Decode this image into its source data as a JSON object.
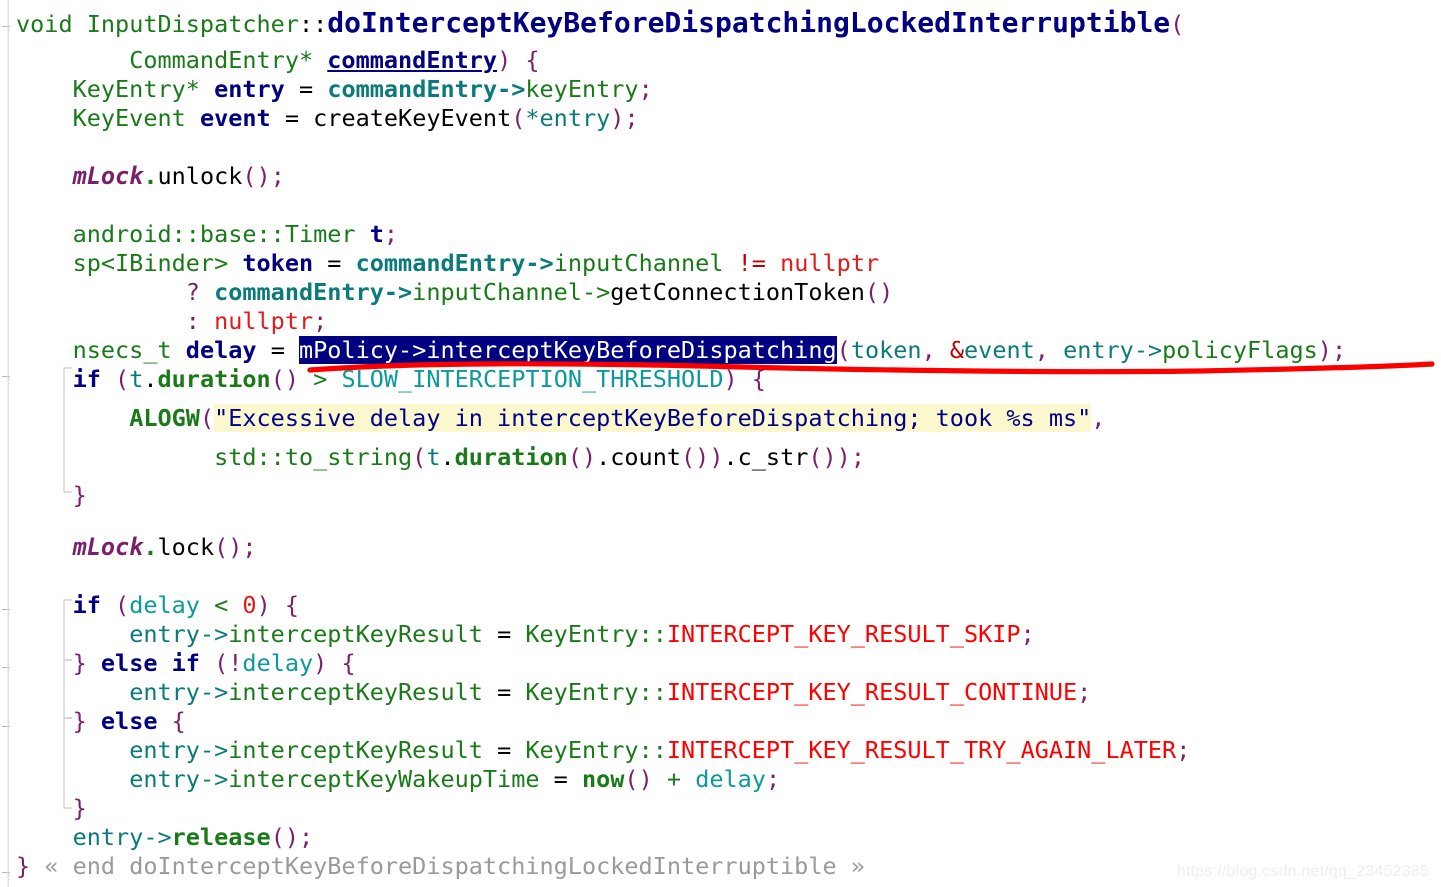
{
  "app": {
    "kind": "source-code-viewer",
    "language": "C++",
    "background": "#ffffff",
    "watermark": "https://blog.csdn.net/qq_23452385"
  },
  "colors": {
    "keyword": "#000080",
    "type": "#1a7a1a",
    "variable_teal": "#0b7a7a",
    "punctuation": "#7a1f6b",
    "constant_red": "#ff0000",
    "nullptr_red": "#e01b1b",
    "string_text": "#00008b",
    "string_highlight_bg": "#fbf8cd",
    "selection_bg": "#000080",
    "selection_fg": "#ffffff",
    "member_purple": "#7a1f6b",
    "cyan_const": "#0b9a9a",
    "fold_gray": "#9a9a9a",
    "annotation_red": "#ff0000",
    "watermark_gray": "#eeeeee"
  },
  "annotation": {
    "type": "hand-drawn-underline",
    "color": "#ff0000",
    "target_line_index": 10,
    "description": "red freehand underline beneath the mPolicy->interceptKeyBeforeDispatching call"
  },
  "selection": {
    "text": "mPolicy->interceptKeyBeforeDispatching",
    "line_index": 10,
    "background": "#000080",
    "foreground": "#ffffff"
  },
  "code": {
    "lines": [
      {
        "i": 0,
        "text": "void InputDispatcher::doInterceptKeyBeforeDispatchingLockedInterruptible(",
        "fold_tick": true
      },
      {
        "i": 1,
        "text": "        CommandEntry* commandEntry) {"
      },
      {
        "i": 2,
        "text": "    KeyEntry* entry = commandEntry->keyEntry;"
      },
      {
        "i": 3,
        "text": "    KeyEvent event = createKeyEvent(*entry);"
      },
      {
        "i": 4,
        "text": ""
      },
      {
        "i": 5,
        "text": "    mLock.unlock();"
      },
      {
        "i": 6,
        "text": ""
      },
      {
        "i": 7,
        "text": "    android::base::Timer t;"
      },
      {
        "i": 8,
        "text": "    sp<IBinder> token = commandEntry->inputChannel != nullptr"
      },
      {
        "i": 9,
        "text": "            ? commandEntry->inputChannel->getConnectionToken()"
      },
      {
        "i": 10,
        "text": "            : nullptr;"
      },
      {
        "i": 11,
        "text": "    nsecs_t delay = mPolicy->interceptKeyBeforeDispatching(token, &event, entry->policyFlags);"
      },
      {
        "i": 12,
        "text": "    if (t.duration() > SLOW_INTERCEPTION_THRESHOLD) {",
        "fold_tick": true
      },
      {
        "i": 13,
        "text": "        ALOGW(\"Excessive delay in interceptKeyBeforeDispatching; took %s ms\","
      },
      {
        "i": 14,
        "text": "              std::to_string(t.duration().count()).c_str());"
      },
      {
        "i": 15,
        "text": "    }"
      },
      {
        "i": 16,
        "text": ""
      },
      {
        "i": 17,
        "text": "    mLock.lock();"
      },
      {
        "i": 18,
        "text": ""
      },
      {
        "i": 19,
        "text": "    if (delay < 0) {",
        "fold_tick": true
      },
      {
        "i": 20,
        "text": "        entry->interceptKeyResult = KeyEntry::INTERCEPT_KEY_RESULT_SKIP;"
      },
      {
        "i": 21,
        "text": "    } else if (!delay) {",
        "fold_tick": true
      },
      {
        "i": 22,
        "text": "        entry->interceptKeyResult = KeyEntry::INTERCEPT_KEY_RESULT_CONTINUE;"
      },
      {
        "i": 23,
        "text": "    } else {",
        "fold_tick": true
      },
      {
        "i": 24,
        "text": "        entry->interceptKeyResult = KeyEntry::INTERCEPT_KEY_RESULT_TRY_AGAIN_LATER;"
      },
      {
        "i": 25,
        "text": "        entry->interceptKeyWakeupTime = now() + delay;"
      },
      {
        "i": 26,
        "text": "    }"
      },
      {
        "i": 27,
        "text": "    entry->release();"
      },
      {
        "i": 28,
        "text": "} « end doInterceptKeyBeforeDispatchingLockedInterruptible »",
        "fold_tick": true
      }
    ],
    "tokens": {
      "l0_void": "void",
      "l0_class": "InputDispatcher",
      "l0_scope": "::",
      "l0_fn": "doInterceptKeyBeforeDispatchingLockedInterruptible",
      "l0_lparen": "(",
      "l1_type": "CommandEntry*",
      "l1_param": "commandEntry",
      "l1_rparen": ")",
      "l1_brace": "{",
      "l2_type": "KeyEntry*",
      "l2_var": "entry",
      "l2_eq": "=",
      "l2_obj": "commandEntry",
      "l2_arrow": "->",
      "l2_field": "keyEntry",
      "l2_semi": ";",
      "l3_type": "KeyEvent",
      "l3_var": "event",
      "l3_eq": "=",
      "l3_fn": "createKeyEvent",
      "l3_arg": "*entry",
      "l5_member": "mLock",
      "l5_dot": ".",
      "l5_fn": "unlock",
      "l7_ns": "android::base::Timer",
      "l7_var": "t",
      "l8_tpl": "sp<IBinder>",
      "l8_var": "token",
      "l8_obj": "commandEntry",
      "l8_field": "inputChannel",
      "l8_op": "!=",
      "l8_null": "nullptr",
      "l9_q": "?",
      "l9_fn": "getConnectionToken",
      "l10_colon": ":",
      "l10_null": "nullptr",
      "l11_type": "nsecs_t",
      "l11_var": "delay",
      "l11_sel": "mPolicy->interceptKeyBeforeDispatching",
      "l11_args": "token, &event, entry->policyFlags",
      "l12_if": "if",
      "l12_t": "t",
      "l12_duration": "duration",
      "l12_gt": ">",
      "l12_const": "SLOW_INTERCEPTION_THRESHOLD",
      "l13_macro": "ALOGW",
      "l13_string": "\"Excessive delay in interceptKeyBeforeDispatching; took %s ms\"",
      "l14_std": "std::to_string",
      "l14_count": "count",
      "l14_cstr": "c_str",
      "l17_member": "mLock",
      "l17_fn": "lock",
      "l19_if": "if",
      "l19_delay": "delay",
      "l19_lt": "<",
      "l19_zero": "0",
      "l20_entry": "entry",
      "l20_field": "interceptKeyResult",
      "l20_cls": "KeyEntry",
      "l20_const": "INTERCEPT_KEY_RESULT_SKIP",
      "l21_else": "else",
      "l21_if": "if",
      "l21_bang": "!",
      "l21_delay": "delay",
      "l22_const": "INTERCEPT_KEY_RESULT_CONTINUE",
      "l23_else": "else",
      "l24_const": "INTERCEPT_KEY_RESULT_TRY_AGAIN_LATER",
      "l25_field": "interceptKeyWakeupTime",
      "l25_now": "now",
      "l25_plus": "+",
      "l25_delay": "delay",
      "l27_entry": "entry",
      "l27_release": "release",
      "l28_foldcomment": "« end doInterceptKeyBeforeDispatchingLockedInterruptible »"
    }
  }
}
